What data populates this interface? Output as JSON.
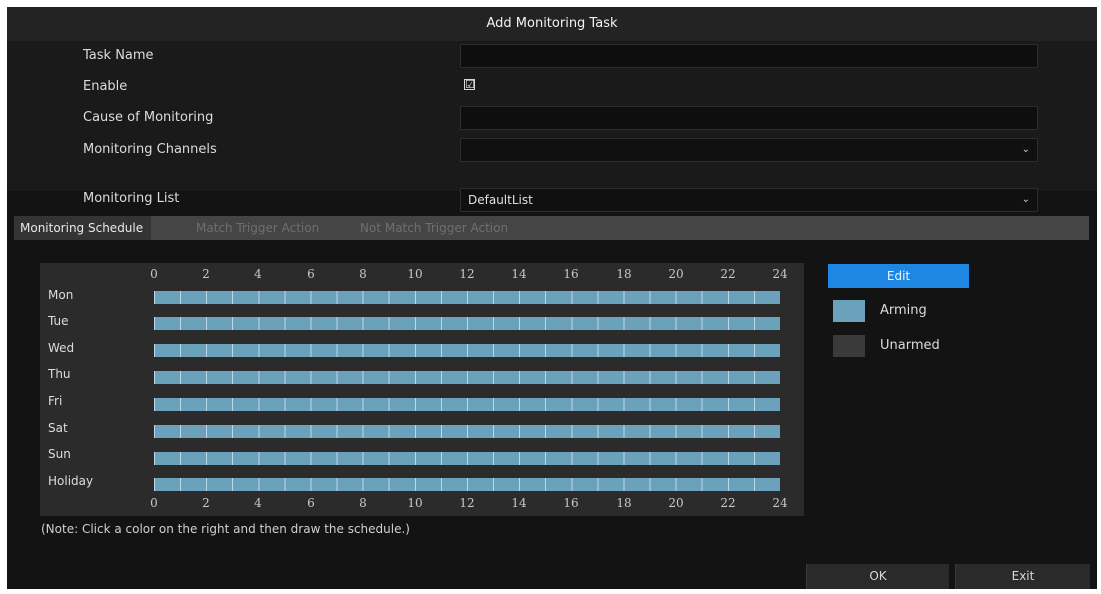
{
  "dialog": {
    "title": "Add Monitoring Task"
  },
  "form": {
    "task_name": {
      "label": "Task Name",
      "value": ""
    },
    "enable": {
      "label": "Enable",
      "checked": true,
      "check_glyph": "☑"
    },
    "cause": {
      "label": "Cause of Monitoring",
      "value": ""
    },
    "channels": {
      "label": "Monitoring Channels",
      "value": ""
    },
    "list": {
      "label": "Monitoring List",
      "value": "DefaultList"
    }
  },
  "tabs": [
    {
      "label": "Monitoring Schedule",
      "active": true
    },
    {
      "label": "Match Trigger Action",
      "active": false
    },
    {
      "label": "Not Match Trigger Action",
      "active": false
    }
  ],
  "schedule": {
    "hours": [
      "0",
      "2",
      "4",
      "6",
      "8",
      "10",
      "12",
      "14",
      "16",
      "18",
      "20",
      "22",
      "24"
    ],
    "days": [
      "Mon",
      "Tue",
      "Wed",
      "Thu",
      "Fri",
      "Sat",
      "Sun",
      "Holiday"
    ],
    "note": "(Note: Click a color on the right and then draw the schedule.)"
  },
  "legend": {
    "edit_label": "Edit",
    "arming_label": "Arming",
    "unarmed_label": "Unarmed"
  },
  "colors": {
    "arming": "#6aa2bb",
    "unarmed": "#3a3a3a",
    "accent": "#1e87e3"
  },
  "buttons": {
    "ok": "OK",
    "exit": "Exit"
  }
}
